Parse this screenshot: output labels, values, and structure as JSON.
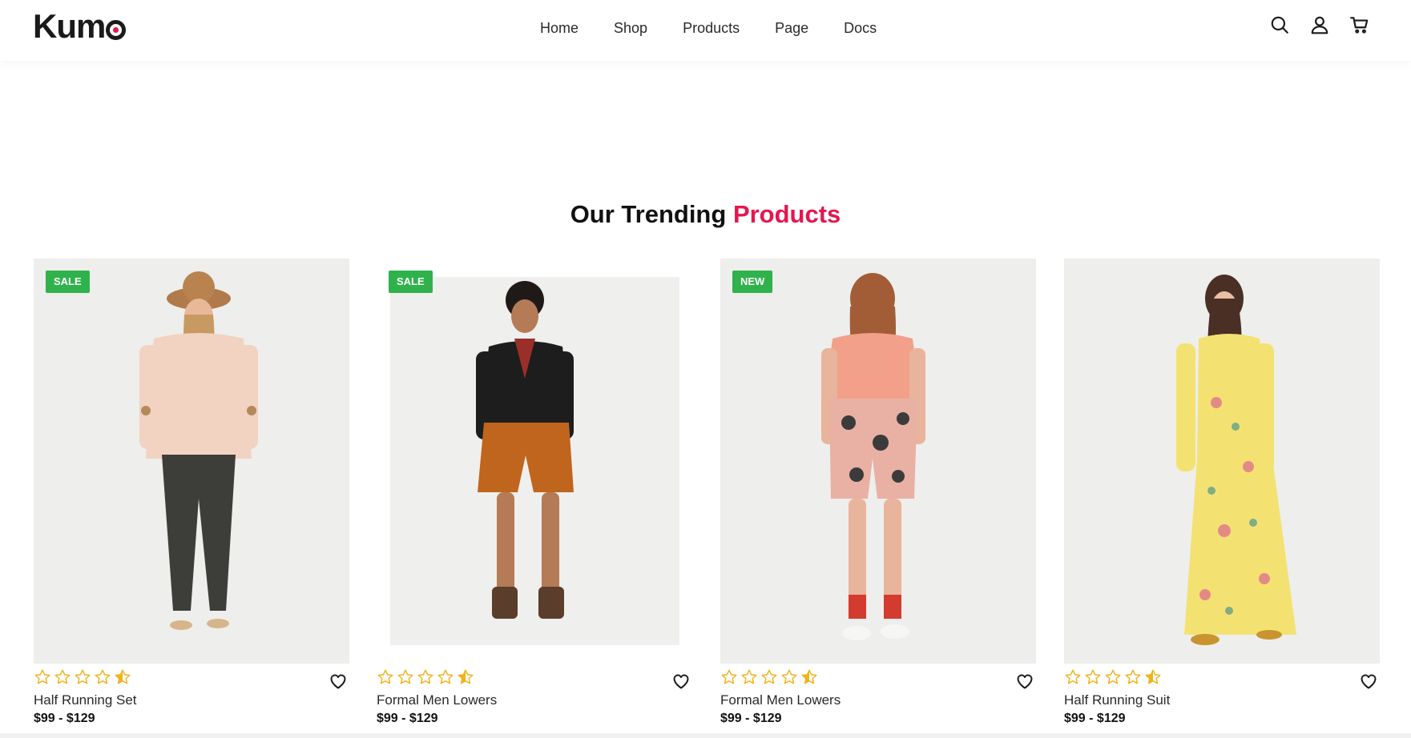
{
  "header": {
    "logo": "Kum",
    "nav": [
      {
        "label": "Home"
      },
      {
        "label": "Shop"
      },
      {
        "label": "Products"
      },
      {
        "label": "Page"
      },
      {
        "label": "Docs"
      }
    ],
    "icons": [
      "search-icon",
      "user-icon",
      "cart-icon"
    ]
  },
  "section": {
    "title_main": "Our Trending",
    "title_accent": "Products"
  },
  "colors": {
    "accent": "#e5164e",
    "badge_green": "#2fb24c",
    "star": "#f2b21b",
    "text": "#1a1a1a"
  },
  "products": [
    {
      "badge": "SALE",
      "name": "Half Running Set",
      "price": "$99 - $129",
      "rating": 4.5
    },
    {
      "badge": "SALE",
      "name": "Formal Men Lowers",
      "price": "$99 - $129",
      "rating": 4.5
    },
    {
      "badge": "NEW",
      "name": "Formal Men Lowers",
      "price": "$99 - $129",
      "rating": 4.5
    },
    {
      "badge": "",
      "name": "Half Running Suit",
      "price": "$99 - $129",
      "rating": 4.5
    }
  ]
}
